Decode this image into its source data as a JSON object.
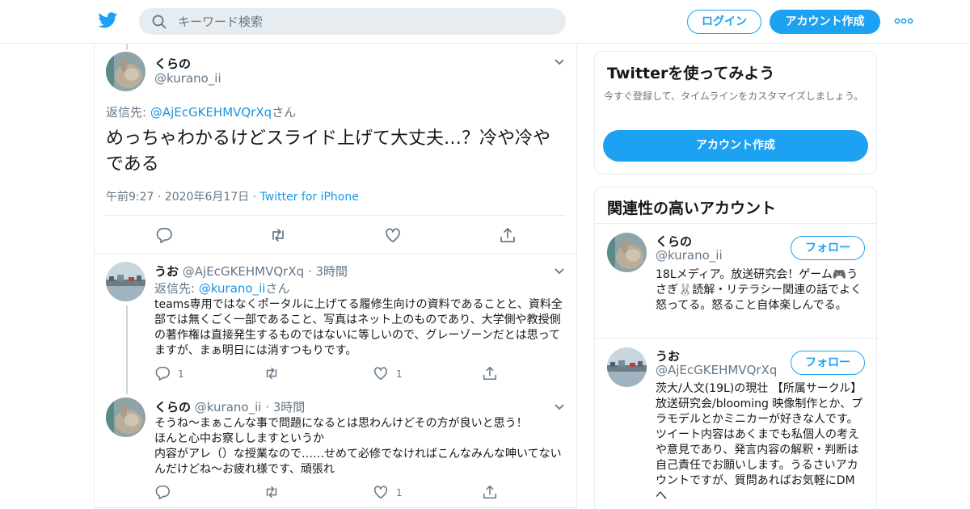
{
  "topbar": {
    "search_placeholder": "キーワード検索",
    "login": "ログイン",
    "signup": "アカウント作成"
  },
  "main_tweet": {
    "name": "くらの",
    "handle": "@kurano_ii",
    "reply_prefix": "返信先: ",
    "reply_to": "@AjEcGKEHMVQrXq",
    "reply_suffix": "さん",
    "text": "めっちゃわかるけどスライド上げて大丈夫…？冷や冷やである",
    "time": "午前9:27",
    "date": "2020年6月17日",
    "source": "Twitter for iPhone",
    "dot": "·"
  },
  "replies": [
    {
      "name": "うお",
      "handle": "@AjEcGKEHMVQrXq",
      "age": "3時間",
      "dot": "·",
      "reply_prefix": "返信先: ",
      "reply_to": "@kurano_ii",
      "reply_suffix": "さん",
      "text": "teams専用ではなくポータルに上げてる履修生向けの資料であることと、資料全部では無くごく一部であること、写真はネット上のものであり、大学側や教授側の著作権は直接発生するものではないに等しいので、グレーゾーンだとは思ってますが、まぁ明日には消すつもりです。",
      "reply_count": "1",
      "like_count": "1"
    },
    {
      "name": "くらの",
      "handle": "@kurano_ii",
      "age": "3時間",
      "dot": "·",
      "text": "そうね～まぁこんな事で問題になるとは思わんけどその方が良いと思う！\nほんと心中お察ししますというか\n内容がアレ（）な授業なので……せめて必修でなければこんなみんな呻いてないんだけどね～お疲れ様です、頑張れ",
      "reply_count": "",
      "like_count": "1"
    }
  ],
  "sidebar": {
    "try_title": "Twitterを使ってみよう",
    "try_desc": "今すぐ登録して、タイムラインをカスタマイズしましょう。",
    "try_button": "アカウント作成",
    "related_title": "関連性の高いアカウント",
    "follow_label": "フォロー",
    "accounts": [
      {
        "name": "くらの",
        "handle": "@kurano_ii",
        "bio": "18Lメディア。放送研究会！ゲーム🎮うさぎ🐰読解・リテラシー関連の話でよく怒ってる。怒ること自体楽しんでる。"
      },
      {
        "name": "うお",
        "handle": "@AjEcGKEHMVQrXq",
        "bio": "茨大/人文(19L)の現壮 【所属サークル】放送研究会/blooming 映像制作とか、プラモデルとかミニカーが好きな人です。 ツイート内容はあくまでも私個人の考えや意見であり、発言内容の解釈・判断は自己責任でお願いします。うるさいアカウントですが、質問あればお気軽にDMへ"
      }
    ]
  },
  "colors": {
    "accent": "#1da1f2",
    "link": "#1b95e0",
    "muted": "#657786",
    "border": "#e6ecf0"
  }
}
